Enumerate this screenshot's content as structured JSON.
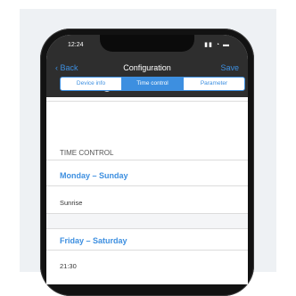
{
  "status": {
    "time": "12:24",
    "icons": "▮▮ ◔ ▬"
  },
  "nav": {
    "back": "Back",
    "title": "Configuration",
    "save": "Save"
  },
  "tabs": [
    {
      "label": "Device info",
      "active": false
    },
    {
      "label": "Time control",
      "active": true
    },
    {
      "label": "Parameter",
      "active": false
    }
  ],
  "section": {
    "header": "TIME CONTROL"
  },
  "groups": [
    {
      "title": "Monday – Sunday",
      "value": "Sunrise"
    },
    {
      "title": "Friday – Saturday",
      "value": "21:30"
    }
  ],
  "colors": {
    "accent": "#3d8fe0",
    "navbar": "#2e2e2e"
  }
}
